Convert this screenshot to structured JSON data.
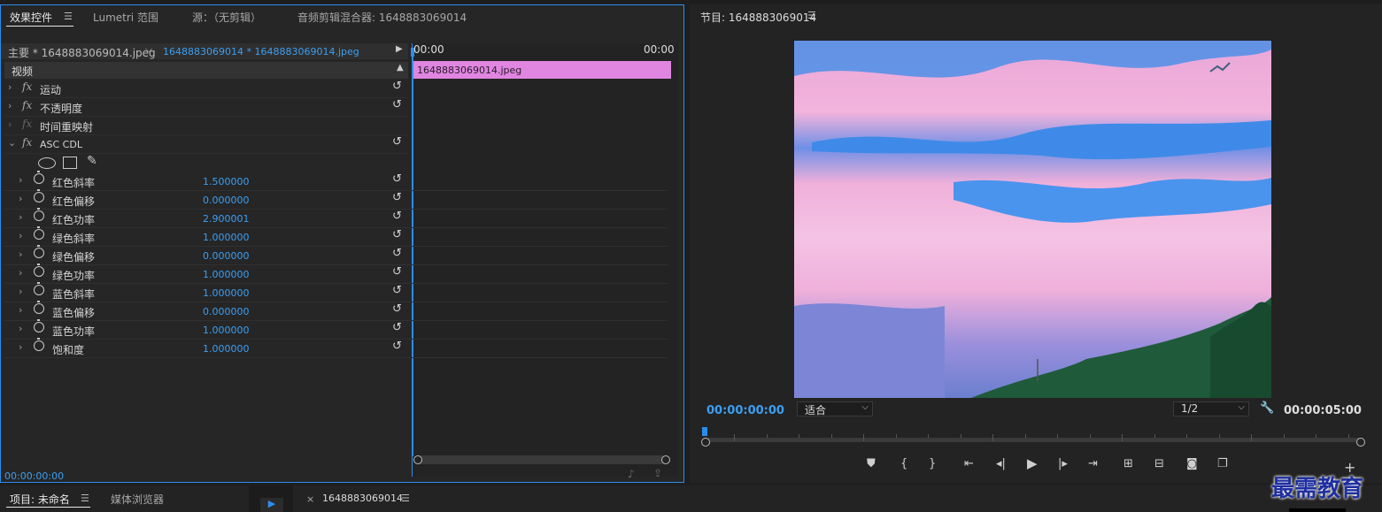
{
  "effects_panel": {
    "tabs": [
      {
        "label": "效果控件"
      },
      {
        "label": "Lumetri 范围"
      },
      {
        "label": "源：（无剪辑）"
      },
      {
        "label": "音频剪辑混合器: 1648883069014"
      }
    ],
    "master_label": "主要 * 1648883069014.jpeg",
    "sequence_label": "1648883069014 * 1648883069014.jpeg",
    "time_start": "00:00",
    "time_end": "00:00",
    "clip_name": "1648883069014.jpeg",
    "video_header": "视频",
    "effects": [
      {
        "label": "运动"
      },
      {
        "label": "不透明度"
      },
      {
        "label": "时间重映射"
      },
      {
        "label": "ASC CDL"
      }
    ],
    "params": [
      {
        "label": "红色斜率",
        "value": "1.500000"
      },
      {
        "label": "红色偏移",
        "value": "0.000000"
      },
      {
        "label": "红色功率",
        "value": "2.900001"
      },
      {
        "label": "绿色斜率",
        "value": "1.000000"
      },
      {
        "label": "绿色偏移",
        "value": "0.000000"
      },
      {
        "label": "绿色功率",
        "value": "1.000000"
      },
      {
        "label": "蓝色斜率",
        "value": "1.000000"
      },
      {
        "label": "蓝色偏移",
        "value": "0.000000"
      },
      {
        "label": "蓝色功率",
        "value": "1.000000"
      },
      {
        "label": "饱和度",
        "value": "1.000000"
      }
    ],
    "current_time": "00:00:00:00"
  },
  "program_monitor": {
    "title": "节目: 1648883069014",
    "current_time": "00:00:00:00",
    "fit_label": "适合",
    "resolution": "1/2",
    "duration": "00:00:05:00"
  },
  "bottom": {
    "project_tab": "项目: 未命名",
    "media_browser_tab": "媒体浏览器",
    "timeline_tab": "1648883069014",
    "close_symbol": "×"
  },
  "watermark": "最需教育",
  "colors": {
    "accent": "#2d8ceb",
    "value_blue": "#3d9ef0",
    "clip_pink": "#e086e0"
  }
}
